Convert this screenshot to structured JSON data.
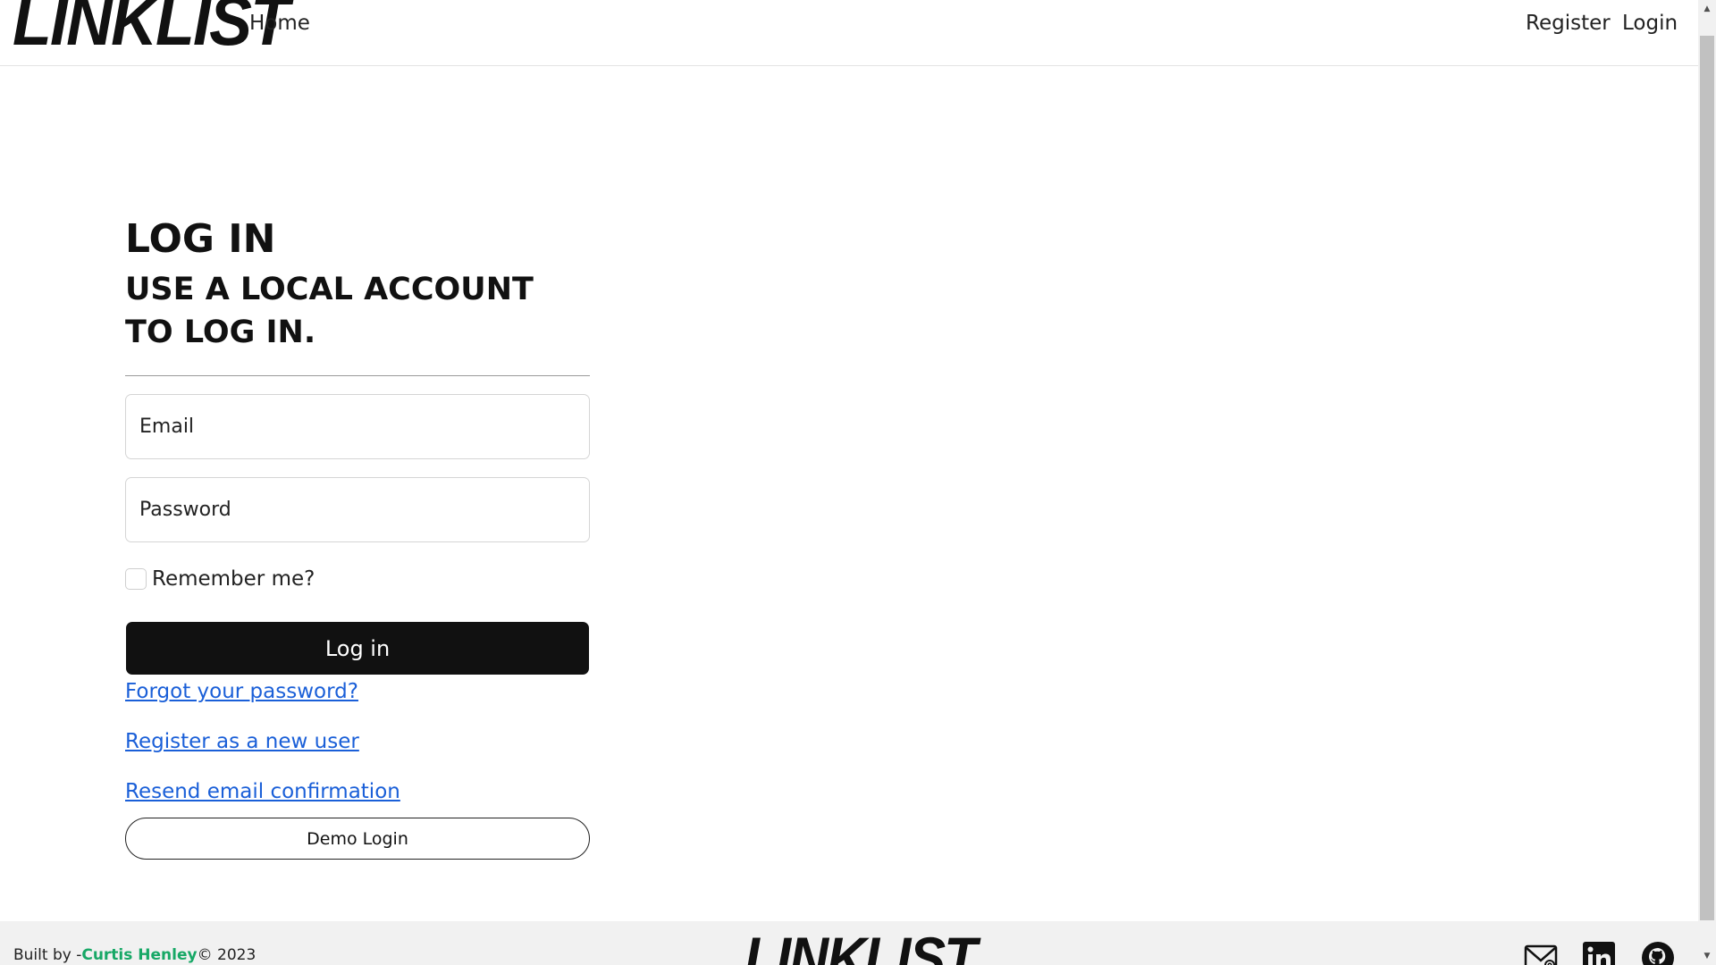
{
  "navbar": {
    "logo": "LINKLIST",
    "home": "Home",
    "register": "Register",
    "login": "Login"
  },
  "main": {
    "title": "LOG IN",
    "subtitle": "USE A LOCAL ACCOUNT TO LOG IN.",
    "email_placeholder": "Email",
    "password_placeholder": "Password",
    "remember_label": "Remember me?",
    "login_button": "Log in",
    "forgot_link": "Forgot your password?",
    "register_link": "Register as a new user",
    "resend_link": "Resend email confirmation",
    "demo_button": "Demo Login"
  },
  "footer": {
    "built_by": "Built by -",
    "author": "Curtis Henley",
    "copyright": "© 2023",
    "logo": "LINKLIST",
    "icons": [
      "mail-icon",
      "linkedin-icon",
      "github-icon"
    ]
  },
  "colors": {
    "primary": "#111111",
    "link": "#1a5fd8",
    "author": "#17a866",
    "footer_bg": "#f1f1f1"
  }
}
